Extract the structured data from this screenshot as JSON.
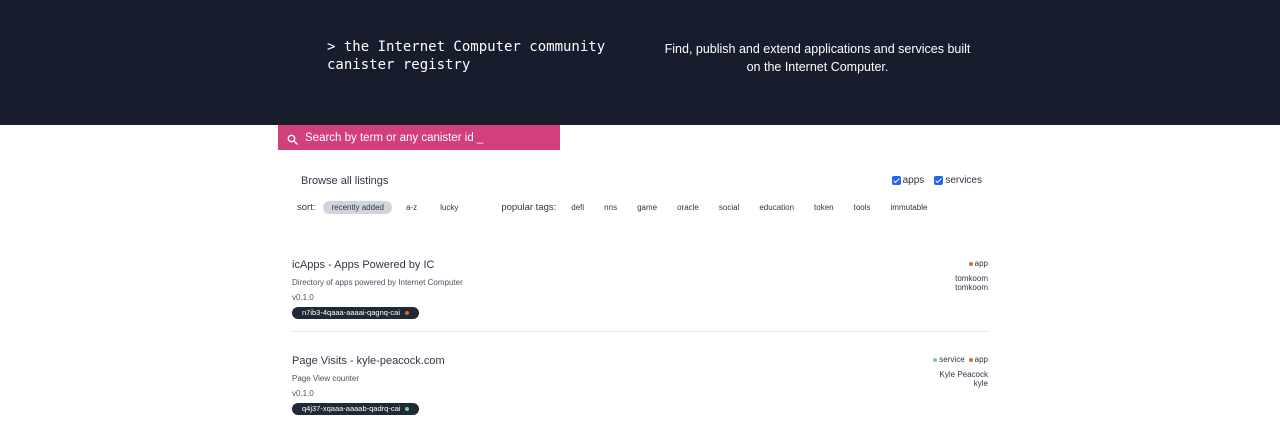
{
  "hero": {
    "tagline": "> the Internet Computer community\ncanister registry",
    "description": "Find, publish and extend applications and services built on the Internet Computer."
  },
  "search": {
    "placeholder": "Search by term or any canister id _",
    "icon": "search-icon"
  },
  "browse": {
    "title": "Browse all listings",
    "filters": [
      {
        "label": "apps",
        "checked": true
      },
      {
        "label": "services",
        "checked": true
      }
    ],
    "sort_label": "sort:",
    "sort_options": [
      "recently added",
      "a-z",
      "lucky"
    ],
    "active_sort": "recently added",
    "tags_label": "popular tags:",
    "tags": [
      "defi",
      "nns",
      "game",
      "oracle",
      "social",
      "education",
      "token",
      "tools",
      "immutable"
    ]
  },
  "listings": [
    {
      "title": "icApps - Apps Powered by IC",
      "description": "Directory of apps powered by Internet Computer",
      "version": "v0.1.0",
      "canister_id": "n7ib3-4qaaa-aaaai-qagnq-cai",
      "types": [
        "app"
      ],
      "author": "tomkoom",
      "handle": "tomkoom"
    },
    {
      "title": "Page Visits - kyle-peacock.com",
      "description": "Page View counter",
      "version": "v0.1.0",
      "canister_id": "q4j37-xqaaa-aaaab-qadrq-cai",
      "types": [
        "service",
        "app"
      ],
      "author": "Kyle Peacock",
      "handle": "kyle"
    }
  ],
  "colors": {
    "hero_bg": "#171d2c",
    "search_bg": "#d23f7b",
    "app_dot": "#dd6b20",
    "service_dot": "#68d391",
    "pill_bg": "#1f2937"
  }
}
